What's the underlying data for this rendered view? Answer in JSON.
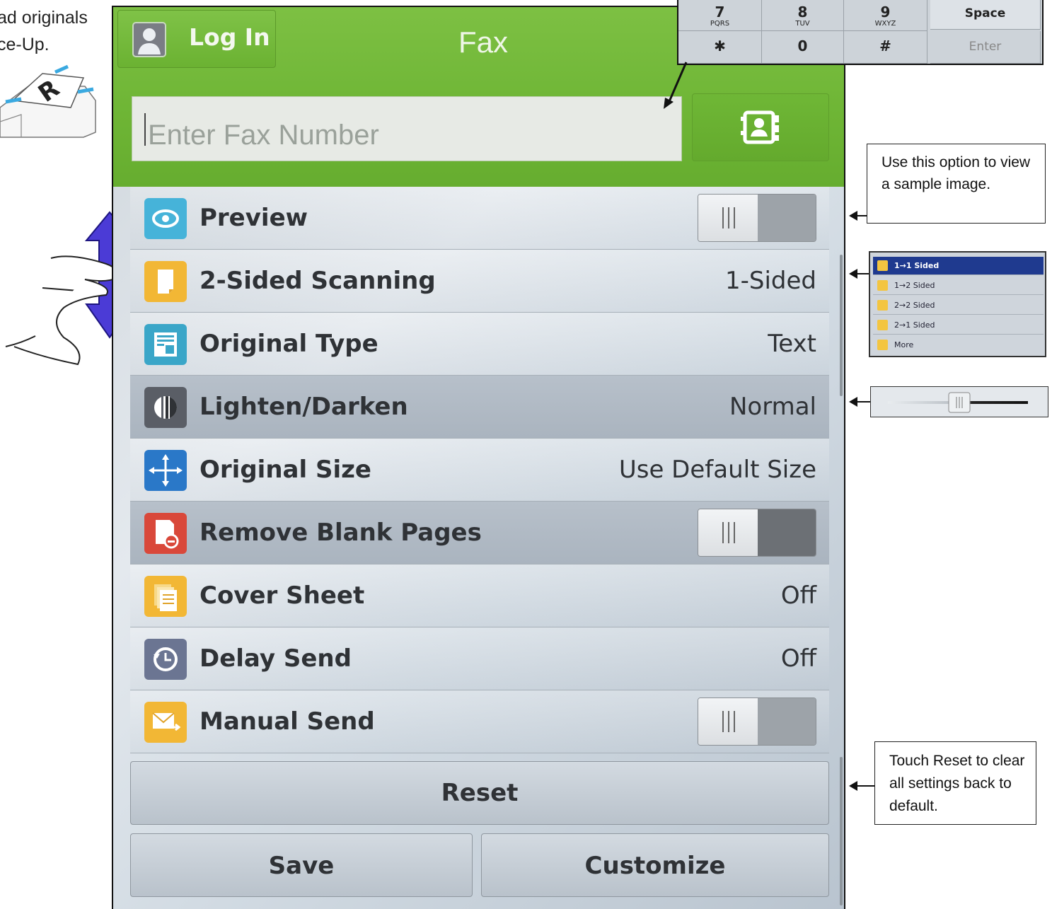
{
  "instructions": {
    "line1": "ad originals",
    "line2": "ce-Up."
  },
  "header": {
    "login_label": "Log In",
    "title": "Fax",
    "fax_placeholder": "Enter Fax Number"
  },
  "settings": [
    {
      "name": "Preview",
      "type": "toggle",
      "icon": "eye-icon",
      "icon_color": "#46b3d9"
    },
    {
      "name": "2-Sided Scanning",
      "value": "1-Sided",
      "icon": "page-icon",
      "icon_color": "#f2b735"
    },
    {
      "name": "Original Type",
      "value": "Text",
      "icon": "document-type-icon",
      "icon_color": "#3aa6c8"
    },
    {
      "name": "Lighten/Darken",
      "value": "Normal",
      "icon": "contrast-icon",
      "icon_color": "#5a5e66"
    },
    {
      "name": "Original Size",
      "value": "Use Default Size",
      "icon": "resize-arrows-icon",
      "icon_color": "#2a78c8"
    },
    {
      "name": "Remove Blank Pages",
      "type": "toggle",
      "icon": "remove-page-icon",
      "icon_color": "#d9483a"
    },
    {
      "name": "Cover Sheet",
      "value": "Off",
      "icon": "cover-sheet-icon",
      "icon_color": "#f2b735"
    },
    {
      "name": "Delay Send",
      "value": "Off",
      "icon": "clock-icon",
      "icon_color": "#6b7592"
    },
    {
      "name": "Manual Send",
      "type": "toggle",
      "icon": "envelope-icon",
      "icon_color": "#f2b735"
    }
  ],
  "buttons": {
    "reset": "Reset",
    "save": "Save",
    "customize": "Customize"
  },
  "keypad": {
    "keys": [
      {
        "big": "7",
        "sub": "PQRS"
      },
      {
        "big": "8",
        "sub": "TUV"
      },
      {
        "big": "9",
        "sub": "WXYZ"
      },
      {
        "big": "Space",
        "sub": ""
      },
      {
        "big": "✱",
        "sub": ""
      },
      {
        "big": "0",
        "sub": ""
      },
      {
        "big": "#",
        "sub": ""
      },
      {
        "big": "Enter",
        "sub": ""
      }
    ]
  },
  "callouts": {
    "preview_note": "Use this option to view a sample image.",
    "reset_note": "Touch Reset to clear all settings back to default."
  },
  "sided_menu": {
    "items": [
      "1→1 Sided",
      "1→2 Sided",
      "2→2 Sided",
      "2→1 Sided",
      "More"
    ],
    "selected": "1→1 Sided"
  },
  "colors": {
    "header_green": "#6eb535",
    "selected_blue": "#1f3a8f"
  }
}
